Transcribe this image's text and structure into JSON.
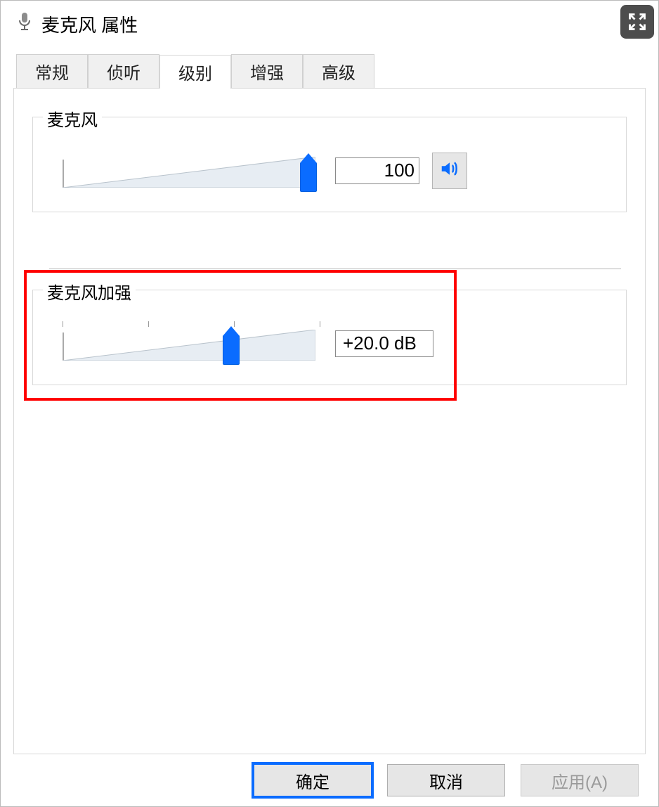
{
  "window": {
    "title": "麦克风 属性",
    "icon_name": "microphone-icon"
  },
  "tabs": {
    "items": [
      {
        "label": "常规",
        "active": false
      },
      {
        "label": "侦听",
        "active": false
      },
      {
        "label": "级别",
        "active": true
      },
      {
        "label": "增强",
        "active": false
      },
      {
        "label": "高级",
        "active": false
      }
    ]
  },
  "level_tab": {
    "mic_group": {
      "legend": "麦克风",
      "value_text": "100",
      "slider_percent": 100,
      "mute_icon_name": "speaker-on-icon"
    },
    "boost_group": {
      "legend": "麦克风加强",
      "value_text": "+20.0 dB",
      "slider_percent": 66,
      "highlighted": true
    }
  },
  "buttons": {
    "ok": "确定",
    "cancel": "取消",
    "apply": "应用(A)"
  },
  "colors": {
    "accent": "#0a6cff",
    "highlight": "#ff0000"
  }
}
